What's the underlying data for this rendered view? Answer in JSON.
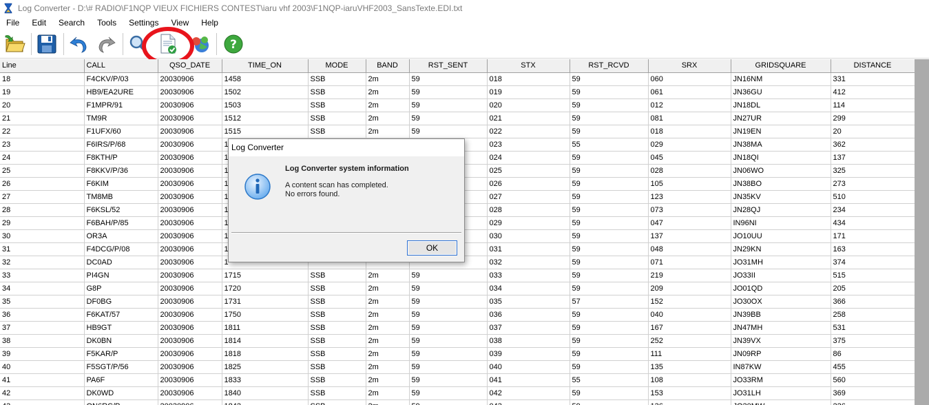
{
  "window": {
    "title": "Log Converter - D:\\# RADIO\\F1NQP VIEUX FICHIERS CONTEST\\iaru vhf 2003\\F1NQP-iaruVHF2003_SansTexte.EDI.txt",
    "app_icon": "hourglass-icon"
  },
  "menu": [
    "File",
    "Edit",
    "Search",
    "Tools",
    "Settings",
    "View",
    "Help"
  ],
  "toolbar": {
    "buttons": [
      "open-folder-icon",
      "save-icon",
      "undo-icon",
      "redo-icon",
      "search-icon",
      "check-file-icon",
      "convert-globe-icon",
      "help-icon"
    ],
    "highlight_color": "#e8141c"
  },
  "grid": {
    "columns": [
      "Line",
      "CALL",
      "QSO_DATE",
      "TIME_ON",
      "MODE",
      "BAND",
      "RST_SENT",
      "STX",
      "RST_RCVD",
      "SRX",
      "GRIDSQUARE",
      "DISTANCE"
    ],
    "rows": [
      [
        "18",
        "F4CKV/P/03",
        "20030906",
        "1458",
        "SSB",
        "2m",
        "59",
        "018",
        "59",
        "060",
        "JN16NM",
        "331"
      ],
      [
        "19",
        "HB9/EA2URE",
        "20030906",
        "1502",
        "SSB",
        "2m",
        "59",
        "019",
        "59",
        "061",
        "JN36GU",
        "412"
      ],
      [
        "20",
        "F1MPR/91",
        "20030906",
        "1503",
        "SSB",
        "2m",
        "59",
        "020",
        "59",
        "012",
        "JN18DL",
        "114"
      ],
      [
        "21",
        "TM9R",
        "20030906",
        "1512",
        "SSB",
        "2m",
        "59",
        "021",
        "59",
        "081",
        "JN27UR",
        "299"
      ],
      [
        "22",
        "F1UFX/60",
        "20030906",
        "1515",
        "SSB",
        "2m",
        "59",
        "022",
        "59",
        "018",
        "JN19EN",
        "20"
      ],
      [
        "23",
        "F6IRS/P/68",
        "20030906",
        "1",
        "",
        "",
        "",
        "023",
        "55",
        "029",
        "JN38MA",
        "362"
      ],
      [
        "24",
        "F8KTH/P",
        "20030906",
        "1",
        "",
        "",
        "",
        "024",
        "59",
        "045",
        "JN18QI",
        "137"
      ],
      [
        "25",
        "F8KKV/P/36",
        "20030906",
        "1",
        "",
        "",
        "",
        "025",
        "59",
        "028",
        "JN06WO",
        "325"
      ],
      [
        "26",
        "F6KIM",
        "20030906",
        "1",
        "",
        "",
        "",
        "026",
        "59",
        "105",
        "JN38BO",
        "273"
      ],
      [
        "27",
        "TM8MB",
        "20030906",
        "1",
        "",
        "",
        "",
        "027",
        "59",
        "123",
        "JN35KV",
        "510"
      ],
      [
        "28",
        "F6KSL/52",
        "20030906",
        "1",
        "",
        "",
        "",
        "028",
        "59",
        "073",
        "JN28QJ",
        "234"
      ],
      [
        "29",
        "F6BAH/P/85",
        "20030906",
        "1",
        "",
        "",
        "",
        "029",
        "59",
        "047",
        "IN96NI",
        "434"
      ],
      [
        "30",
        "OR3A",
        "20030906",
        "1",
        "",
        "",
        "",
        "030",
        "59",
        "137",
        "JO10UU",
        "171"
      ],
      [
        "31",
        "F4DCG/P/08",
        "20030906",
        "1",
        "",
        "",
        "",
        "031",
        "59",
        "048",
        "JN29KN",
        "163"
      ],
      [
        "32",
        "DC0AD",
        "20030906",
        "1",
        "",
        "",
        "",
        "032",
        "59",
        "071",
        "JO31MH",
        "374"
      ],
      [
        "33",
        "PI4GN",
        "20030906",
        "1715",
        "SSB",
        "2m",
        "59",
        "033",
        "59",
        "219",
        "JO33II",
        "515"
      ],
      [
        "34",
        "G8P",
        "20030906",
        "1720",
        "SSB",
        "2m",
        "59",
        "034",
        "59",
        "209",
        "JO01QD",
        "205"
      ],
      [
        "35",
        "DF0BG",
        "20030906",
        "1731",
        "SSB",
        "2m",
        "59",
        "035",
        "57",
        "152",
        "JO30OX",
        "366"
      ],
      [
        "36",
        "F6KAT/57",
        "20030906",
        "1750",
        "SSB",
        "2m",
        "59",
        "036",
        "59",
        "040",
        "JN39BB",
        "258"
      ],
      [
        "37",
        "HB9GT",
        "20030906",
        "1811",
        "SSB",
        "2m",
        "59",
        "037",
        "59",
        "167",
        "JN47MH",
        "531"
      ],
      [
        "38",
        "DK0BN",
        "20030906",
        "1814",
        "SSB",
        "2m",
        "59",
        "038",
        "59",
        "252",
        "JN39VX",
        "375"
      ],
      [
        "39",
        "F5KAR/P",
        "20030906",
        "1818",
        "SSB",
        "2m",
        "59",
        "039",
        "59",
        "111",
        "JN09RP",
        "86"
      ],
      [
        "40",
        "F5SGT/P/56",
        "20030906",
        "1825",
        "SSB",
        "2m",
        "59",
        "040",
        "59",
        "135",
        "IN87KW",
        "455"
      ],
      [
        "41",
        "PA6F",
        "20030906",
        "1833",
        "SSB",
        "2m",
        "59",
        "041",
        "55",
        "108",
        "JO33RM",
        "560"
      ],
      [
        "42",
        "DK0WD",
        "20030906",
        "1840",
        "SSB",
        "2m",
        "59",
        "042",
        "59",
        "153",
        "JO31LH",
        "369"
      ],
      [
        "43",
        "ON6RC/P",
        "20030906",
        "1842",
        "SSB",
        "2m",
        "59",
        "043",
        "59",
        "136",
        "JO20MW",
        "226"
      ]
    ]
  },
  "dialog": {
    "title": "Log Converter",
    "heading": "Log Converter system information",
    "message_line1": "A content scan has completed.",
    "message_line2": "No errors found.",
    "ok_label": "OK",
    "icon": "info-icon"
  }
}
